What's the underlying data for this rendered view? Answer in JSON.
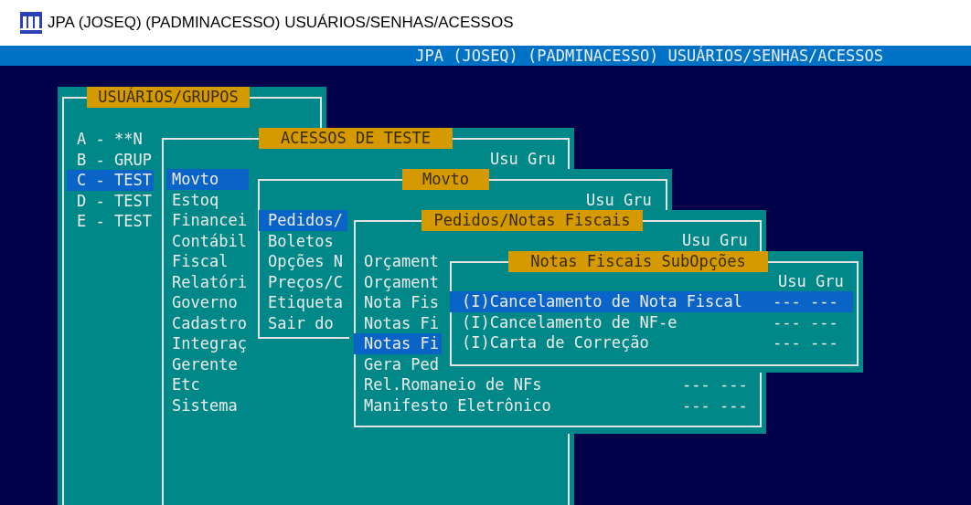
{
  "window": {
    "title": "JPA (JOSEQ) (PADMINACESSO) USUÁRIOS/SENHAS/ACESSOS"
  },
  "header_bar": {
    "text": "JPA (JOSEQ) (PADMINACESSO) USUÁRIOS/SENHAS/ACESSOS"
  },
  "panels": [
    {
      "title": "USUÁRIOS/GRUPOS",
      "items": [
        {
          "label": "A -  **N",
          "selected": false
        },
        {
          "label": "B - GRUP",
          "selected": false
        },
        {
          "label": "C - TEST",
          "selected": true
        },
        {
          "label": "D - TEST",
          "selected": false
        },
        {
          "label": "E - TEST",
          "selected": false
        }
      ]
    },
    {
      "title": "ACESSOS DE TESTE",
      "columns": [
        "Usu",
        "Gru"
      ],
      "items": [
        {
          "label": "Movto",
          "selected": true
        },
        {
          "label": "Estoq",
          "selected": false
        },
        {
          "label": "Financei",
          "selected": false
        },
        {
          "label": "Contábil",
          "selected": false
        },
        {
          "label": "Fiscal",
          "selected": false
        },
        {
          "label": "Relatóri",
          "selected": false
        },
        {
          "label": "Governo",
          "selected": false
        },
        {
          "label": "Cadastro",
          "selected": false
        },
        {
          "label": "Integraç",
          "selected": false
        },
        {
          "label": "Gerente",
          "selected": false
        },
        {
          "label": "Etc",
          "selected": false
        },
        {
          "label": "Sistema",
          "selected": false
        }
      ]
    },
    {
      "title": "Movto",
      "columns": [
        "Usu",
        "Gru"
      ],
      "items": [
        {
          "label": "Pedidos/",
          "selected": true
        },
        {
          "label": "Boletos",
          "selected": false
        },
        {
          "label": "Opções N",
          "selected": false
        },
        {
          "label": "Preços/C",
          "selected": false
        },
        {
          "label": "Etiqueta",
          "selected": false
        },
        {
          "label": "Sair do",
          "selected": false
        }
      ]
    },
    {
      "title": "Pedidos/Notas Fiscais",
      "columns": [
        "Usu",
        "Gru"
      ],
      "items": [
        {
          "label": "Orçament",
          "selected": false
        },
        {
          "label": "Orçament",
          "selected": false
        },
        {
          "label": "Nota Fis",
          "selected": false
        },
        {
          "label": "Notas Fi",
          "selected": false
        },
        {
          "label": "Notas Fi",
          "selected": true
        },
        {
          "label": "Gera Ped",
          "selected": false
        },
        {
          "label": "Rel.Romaneio de NFs",
          "selected": false,
          "usu": "---",
          "gru": "---"
        },
        {
          "label": "Manifesto Eletrônico",
          "selected": false,
          "usu": "---",
          "gru": "---"
        }
      ]
    },
    {
      "title": "Notas Fiscais SubOpções",
      "columns": [
        "Usu",
        "Gru"
      ],
      "items": [
        {
          "label": "(I)Cancelamento de Nota Fiscal",
          "selected": true,
          "usu": "---",
          "gru": "---"
        },
        {
          "label": "(I)Cancelamento de NF-e",
          "selected": false,
          "usu": "---",
          "gru": "---"
        },
        {
          "label": "(I)Carta de Correção",
          "selected": false,
          "usu": "---",
          "gru": "---"
        }
      ]
    }
  ]
}
